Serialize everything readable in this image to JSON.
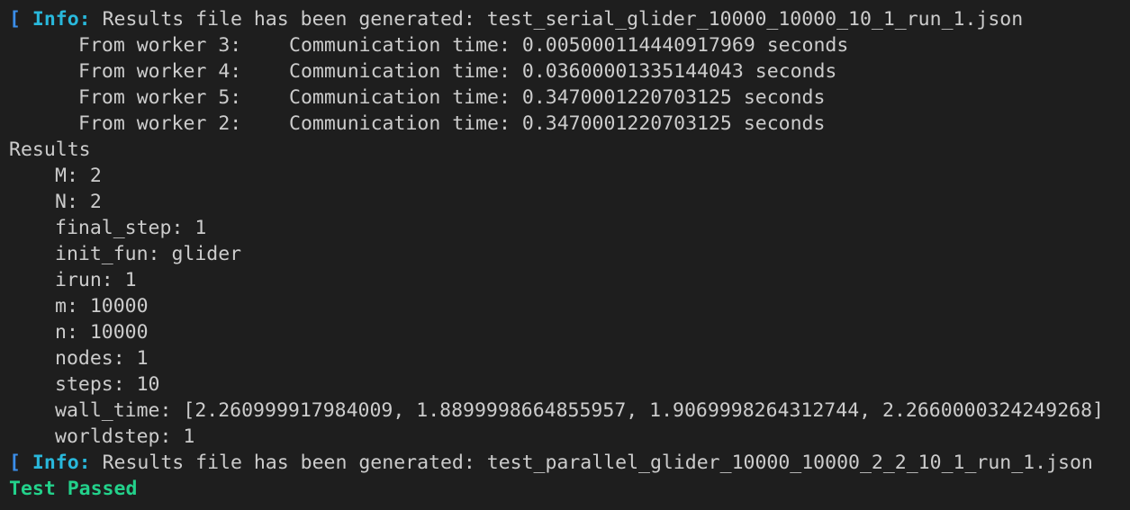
{
  "colors": {
    "background": "#1e1e1e",
    "text": "#cccccc",
    "bracket": "#3b8eea",
    "info": "#29b8db",
    "passed": "#23d18b"
  },
  "info_line_1": {
    "bracket": "[",
    "tag": "Info:",
    "message": "Results file has been generated: test_serial_glider_10000_10000_10_1_run_1.json"
  },
  "workers": [
    {
      "label": "From worker 3:",
      "text": "Communication time: 0.005000114440917969 seconds"
    },
    {
      "label": "From worker 4:",
      "text": "Communication time: 0.03600001335144043 seconds"
    },
    {
      "label": "From worker 5:",
      "text": "Communication time: 0.3470001220703125 seconds"
    },
    {
      "label": "From worker 2:",
      "text": "Communication time: 0.3470001220703125 seconds"
    }
  ],
  "results": {
    "header": "Results",
    "entries": [
      "M: 2",
      "N: 2",
      "final_step: 1",
      "init_fun: glider",
      "irun: 1",
      "m: 10000",
      "n: 10000",
      "nodes: 1",
      "steps: 10",
      "wall_time: [2.260999917984009, 1.8899998664855957, 1.9069998264312744, 2.2660000324249268]",
      "worldstep: 1"
    ]
  },
  "info_line_2": {
    "bracket": "[",
    "tag": "Info:",
    "message": "Results file has been generated: test_parallel_glider_10000_10000_2_2_10_1_run_1.json"
  },
  "status": "Test Passed"
}
